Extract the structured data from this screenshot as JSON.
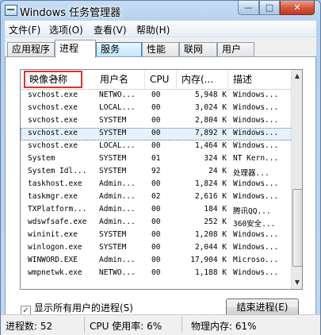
{
  "window": {
    "title": "Windows 任务管理器"
  },
  "menu": [
    "文件(F)",
    "选项(O)",
    "查看(V)",
    "帮助(H)"
  ],
  "tabs": [
    "应用程序",
    "进程",
    "服务",
    "性能",
    "联网",
    "用户"
  ],
  "active_tab": "进程",
  "columns": {
    "name": "映像名称",
    "user": "用户名",
    "cpu": "CPU",
    "mem": "内存(...",
    "desc": "描述"
  },
  "processes": [
    {
      "name": "svchost.exe",
      "user": "NETWO...",
      "cpu": "00",
      "mem": "5,948 K",
      "desc": "Windows..."
    },
    {
      "name": "svchost.exe",
      "user": "LOCAL...",
      "cpu": "00",
      "mem": "3,024 K",
      "desc": "Windows..."
    },
    {
      "name": "svchost.exe",
      "user": "SYSTEM",
      "cpu": "00",
      "mem": "2,804 K",
      "desc": "Windows..."
    },
    {
      "name": "svchost.exe",
      "user": "SYSTEM",
      "cpu": "00",
      "mem": "7,892 K",
      "desc": "Windows..."
    },
    {
      "name": "svchost.exe",
      "user": "LOCAL...",
      "cpu": "00",
      "mem": "1,464 K",
      "desc": "Windows..."
    },
    {
      "name": "System",
      "user": "SYSTEM",
      "cpu": "01",
      "mem": "324 K",
      "desc": "NT Kern..."
    },
    {
      "name": "System Idl...",
      "user": "SYSTEM",
      "cpu": "92",
      "mem": "24 K",
      "desc": "处理器..."
    },
    {
      "name": "taskhost.exe",
      "user": "Admin...",
      "cpu": "00",
      "mem": "1,824 K",
      "desc": "Windows..."
    },
    {
      "name": "taskmgr.exe",
      "user": "Admin...",
      "cpu": "02",
      "mem": "2,616 K",
      "desc": "Windows..."
    },
    {
      "name": "TXPlatform...",
      "user": "Admin...",
      "cpu": "00",
      "mem": "184 K",
      "desc": "腾讯QQ..."
    },
    {
      "name": "wdswfsafe.exe",
      "user": "Admin...",
      "cpu": "00",
      "mem": "252 K",
      "desc": "360安全..."
    },
    {
      "name": "wininit.exe",
      "user": "SYSTEM",
      "cpu": "00",
      "mem": "1,208 K",
      "desc": "Windows..."
    },
    {
      "name": "winlogon.exe",
      "user": "SYSTEM",
      "cpu": "00",
      "mem": "2,044 K",
      "desc": "Windows..."
    },
    {
      "name": "WINWORD.EXE",
      "user": "Admin...",
      "cpu": "00",
      "mem": "17,904 K",
      "desc": "Microso..."
    },
    {
      "name": "wmpnetwk.exe",
      "user": "NETWO...",
      "cpu": "00",
      "mem": "1,188 K",
      "desc": "Windows..."
    }
  ],
  "selected_row": 3,
  "show_all_users": {
    "label": "显示所有用户的进程(S)",
    "checked": true
  },
  "end_process_label": "结束进程(E)",
  "status": {
    "process_count": "进程数: 52",
    "cpu_usage": "CPU 使用率: 6%",
    "physical_memory": "物理内存: 61%"
  }
}
